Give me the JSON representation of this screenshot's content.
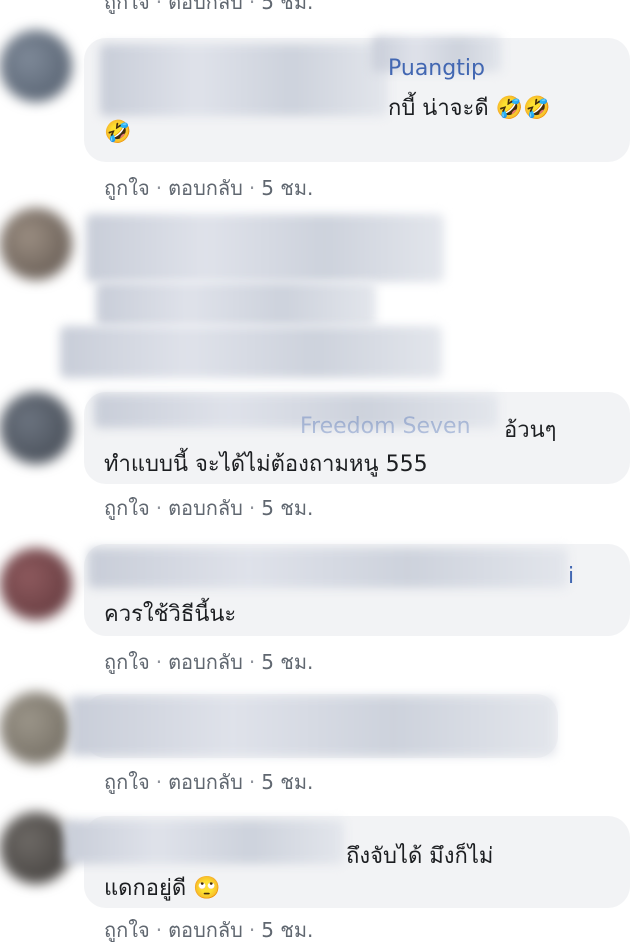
{
  "actions": {
    "like": "ถูกใจ",
    "reply": "ตอบกลับ",
    "separator": "·",
    "time": "5 ชม."
  },
  "comments": [
    {
      "name_fragment": "Puangtip",
      "text_line1": "กบี้ น่าจะดี",
      "emoji_line1": "🤣🤣",
      "emoji_line2": "🤣"
    },
    {
      "name_fragment": "",
      "text_line1": ""
    },
    {
      "name_fragment": "Freedom Seven",
      "text_line1": "อ้วนๆ",
      "text_line2": "ทำแบบนี้ จะได้ไม่ต้องถามหนู 555"
    },
    {
      "name_fragment": "i",
      "text_line1": "ควรใช้วิธีนี้นะ"
    },
    {
      "name_fragment": "",
      "text_line1": ""
    },
    {
      "name_fragment": "",
      "text_line1": "ถึงจับได้ มึงก็ไม่",
      "text_line2": "แดกอยู่ดี",
      "emoji_line2": "🙄"
    }
  ],
  "colors": {
    "bubble": "#f2f3f5",
    "link": "#4267b2",
    "meta": "#606770"
  }
}
